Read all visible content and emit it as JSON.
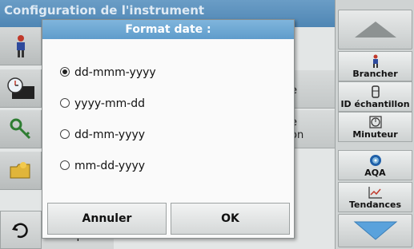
{
  "background": {
    "title": "Configuration de l'instrument",
    "rows": [
      {
        "line1": "e",
        "line2": ""
      },
      {
        "line1": "e",
        "line2": "on"
      }
    ],
    "principal": "Principal"
  },
  "right_panel": {
    "buttons": [
      {
        "label": "Brancher",
        "icon": "person-plug-icon"
      },
      {
        "label": "ID échantillon",
        "icon": "sample-vial-icon"
      },
      {
        "label": "Minuteur",
        "icon": "timer-icon"
      },
      {
        "label": "AQA",
        "icon": "aqa-icon"
      },
      {
        "label": "Tendances",
        "icon": "trend-chart-icon"
      }
    ]
  },
  "dialog": {
    "title": "Format date :",
    "options": [
      {
        "label": "dd-mmm-yyyy",
        "selected": true
      },
      {
        "label": "yyyy-mm-dd",
        "selected": false
      },
      {
        "label": "dd-mm-yyyy",
        "selected": false
      },
      {
        "label": "mm-dd-yyyy",
        "selected": false
      }
    ],
    "cancel_label": "Annuler",
    "ok_label": "OK"
  },
  "colors": {
    "title_bar": "#5f9ccb",
    "dialog_bg": "#fafafa",
    "panel_bg": "#cfd3d3",
    "arrow_blue": "#5aa2dc",
    "arrow_gray": "#8d9292"
  }
}
